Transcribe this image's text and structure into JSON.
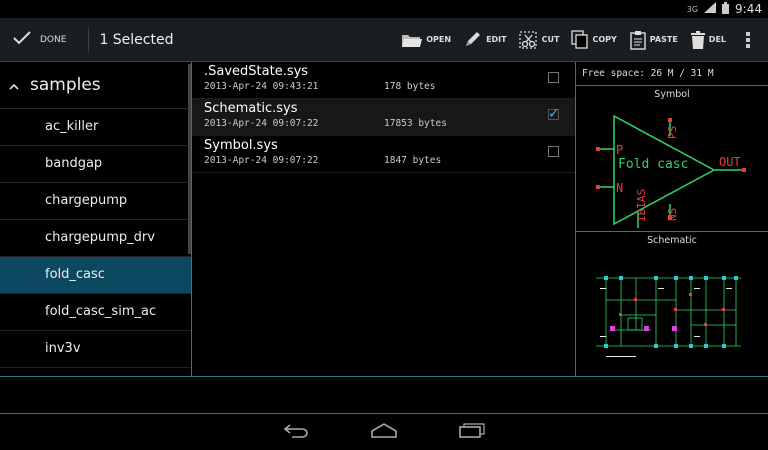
{
  "status": {
    "network": "3G",
    "time": "9:44"
  },
  "actionbar": {
    "done_label": "DONE",
    "selected_count": "1 Selected",
    "actions": [
      {
        "label": "OPEN",
        "icon": "folder-open-icon"
      },
      {
        "label": "EDIT",
        "icon": "pencil-icon"
      },
      {
        "label": "CUT",
        "icon": "scissors-icon"
      },
      {
        "label": "COPY",
        "icon": "copy-icon"
      },
      {
        "label": "PASTE",
        "icon": "clipboard-icon"
      },
      {
        "label": "DEL",
        "icon": "trash-icon"
      }
    ]
  },
  "sidebar": {
    "header": "samples",
    "items": [
      {
        "label": "ac_killer"
      },
      {
        "label": "bandgap"
      },
      {
        "label": "chargepump"
      },
      {
        "label": "chargepump_drv"
      },
      {
        "label": "fold_casc",
        "active": true
      },
      {
        "label": "fold_casc_sim_ac"
      },
      {
        "label": "inv3v"
      }
    ]
  },
  "files": [
    {
      "name": ".SavedState.sys",
      "date": "2013-Apr-24 09:43:21",
      "size": "178 bytes",
      "checked": false
    },
    {
      "name": "Schematic.sys",
      "date": "2013-Apr-24 09:07:22",
      "size": "17853 bytes",
      "checked": true
    },
    {
      "name": "Symbol.sys",
      "date": "2013-Apr-24 09:07:22",
      "size": "1847 bytes",
      "checked": false
    }
  ],
  "preview": {
    "free_space": "Free space: 26 M / 31 M",
    "symbol_title": "Symbol",
    "schematic_title": "Schematic",
    "symbol": {
      "name": "Fold casc",
      "pins": {
        "p": "P",
        "n": "N",
        "out": "OUT",
        "ps": "PS",
        "ns": "NS",
        "ibias": "IBIAS"
      }
    }
  },
  "colors": {
    "accent": "#33b5e5",
    "selected_row": "#0c4860",
    "divider": "#2f7a8a",
    "symbol_green": "#2bd66a",
    "symbol_red": "#e0403a"
  }
}
